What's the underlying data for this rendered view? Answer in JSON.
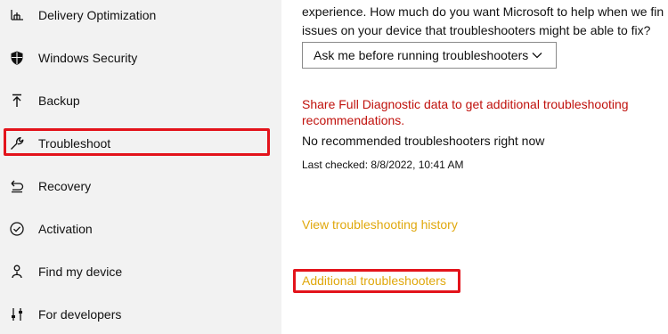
{
  "sidebar": {
    "items": [
      {
        "label": "Delivery Optimization",
        "icon": "delivery-optimization-icon"
      },
      {
        "label": "Windows Security",
        "icon": "shield-icon"
      },
      {
        "label": "Backup",
        "icon": "backup-icon"
      },
      {
        "label": "Troubleshoot",
        "icon": "wrench-icon",
        "selected": true
      },
      {
        "label": "Recovery",
        "icon": "recovery-icon"
      },
      {
        "label": "Activation",
        "icon": "check-circle-icon"
      },
      {
        "label": "Find my device",
        "icon": "person-pin-icon"
      },
      {
        "label": "For developers",
        "icon": "developer-sliders-icon"
      }
    ]
  },
  "main": {
    "description_line1": "experience. How much do you want Microsoft to help when we fin",
    "description_line2": "issues on your device that troubleshooters might be able to fix?",
    "dropdown_value": "Ask me before running troubleshooters",
    "share_link_line1": "Share Full Diagnostic data to get additional troubleshooting",
    "share_link_line2": "recommendations.",
    "no_recommended": "No recommended troubleshooters right now",
    "last_checked": "Last checked: 8/8/2022, 10:41 AM",
    "history_link": "View troubleshooting history",
    "additional_link": "Additional troubleshooters"
  },
  "colors": {
    "sidebar_bg": "#f2f2f2",
    "highlight": "#e3131b",
    "share_link": "#c0110c",
    "accent_link": "#e0a80d"
  }
}
